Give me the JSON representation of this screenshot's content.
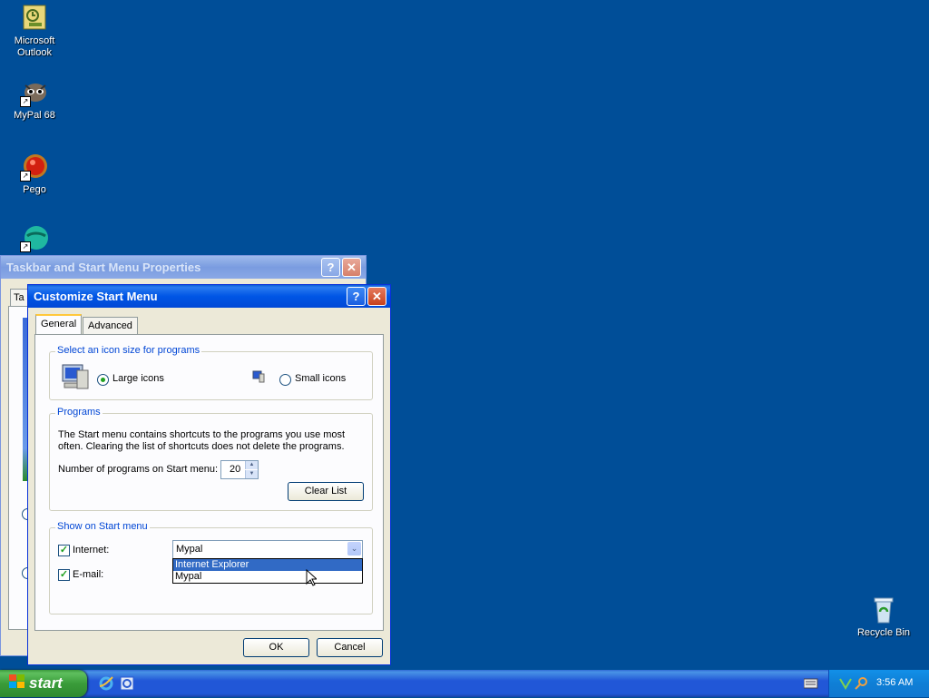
{
  "desktop": {
    "icons": [
      {
        "label": "Microsoft Outlook"
      },
      {
        "label": "MyPal 68"
      },
      {
        "label": "Pego"
      },
      {
        "label": ""
      }
    ],
    "recycle_bin": "Recycle Bin"
  },
  "back_window": {
    "title": "Taskbar and Start Menu Properties",
    "tab_partial": "Ta"
  },
  "dialog": {
    "title": "Customize Start Menu",
    "tabs": [
      "General",
      "Advanced"
    ],
    "icon_size_group": {
      "label": "Select an icon size for programs",
      "large": "Large icons",
      "small": "Small icons",
      "selected": "Large icons"
    },
    "programs_group": {
      "label": "Programs",
      "description": "The Start menu contains shortcuts to the programs you use most often. Clearing the list of shortcuts does not delete the programs.",
      "count_label": "Number of programs on Start menu:",
      "count_value": "20",
      "clear_button": "Clear List"
    },
    "show_group": {
      "label": "Show on Start menu",
      "internet_label": "Internet:",
      "internet_checked": true,
      "internet_value": "Mypal",
      "email_label": "E-mail:",
      "email_checked": true,
      "dropdown_options": [
        "Internet Explorer",
        "Mypal"
      ],
      "highlighted_option": "Internet Explorer"
    },
    "ok_button": "OK",
    "cancel_button": "Cancel"
  },
  "taskbar": {
    "start_label": "start",
    "clock": "3:56 AM"
  },
  "colors": {
    "desktop": "#004e98",
    "selection": "#316ac5",
    "groupbox_label": "#0046d5"
  }
}
